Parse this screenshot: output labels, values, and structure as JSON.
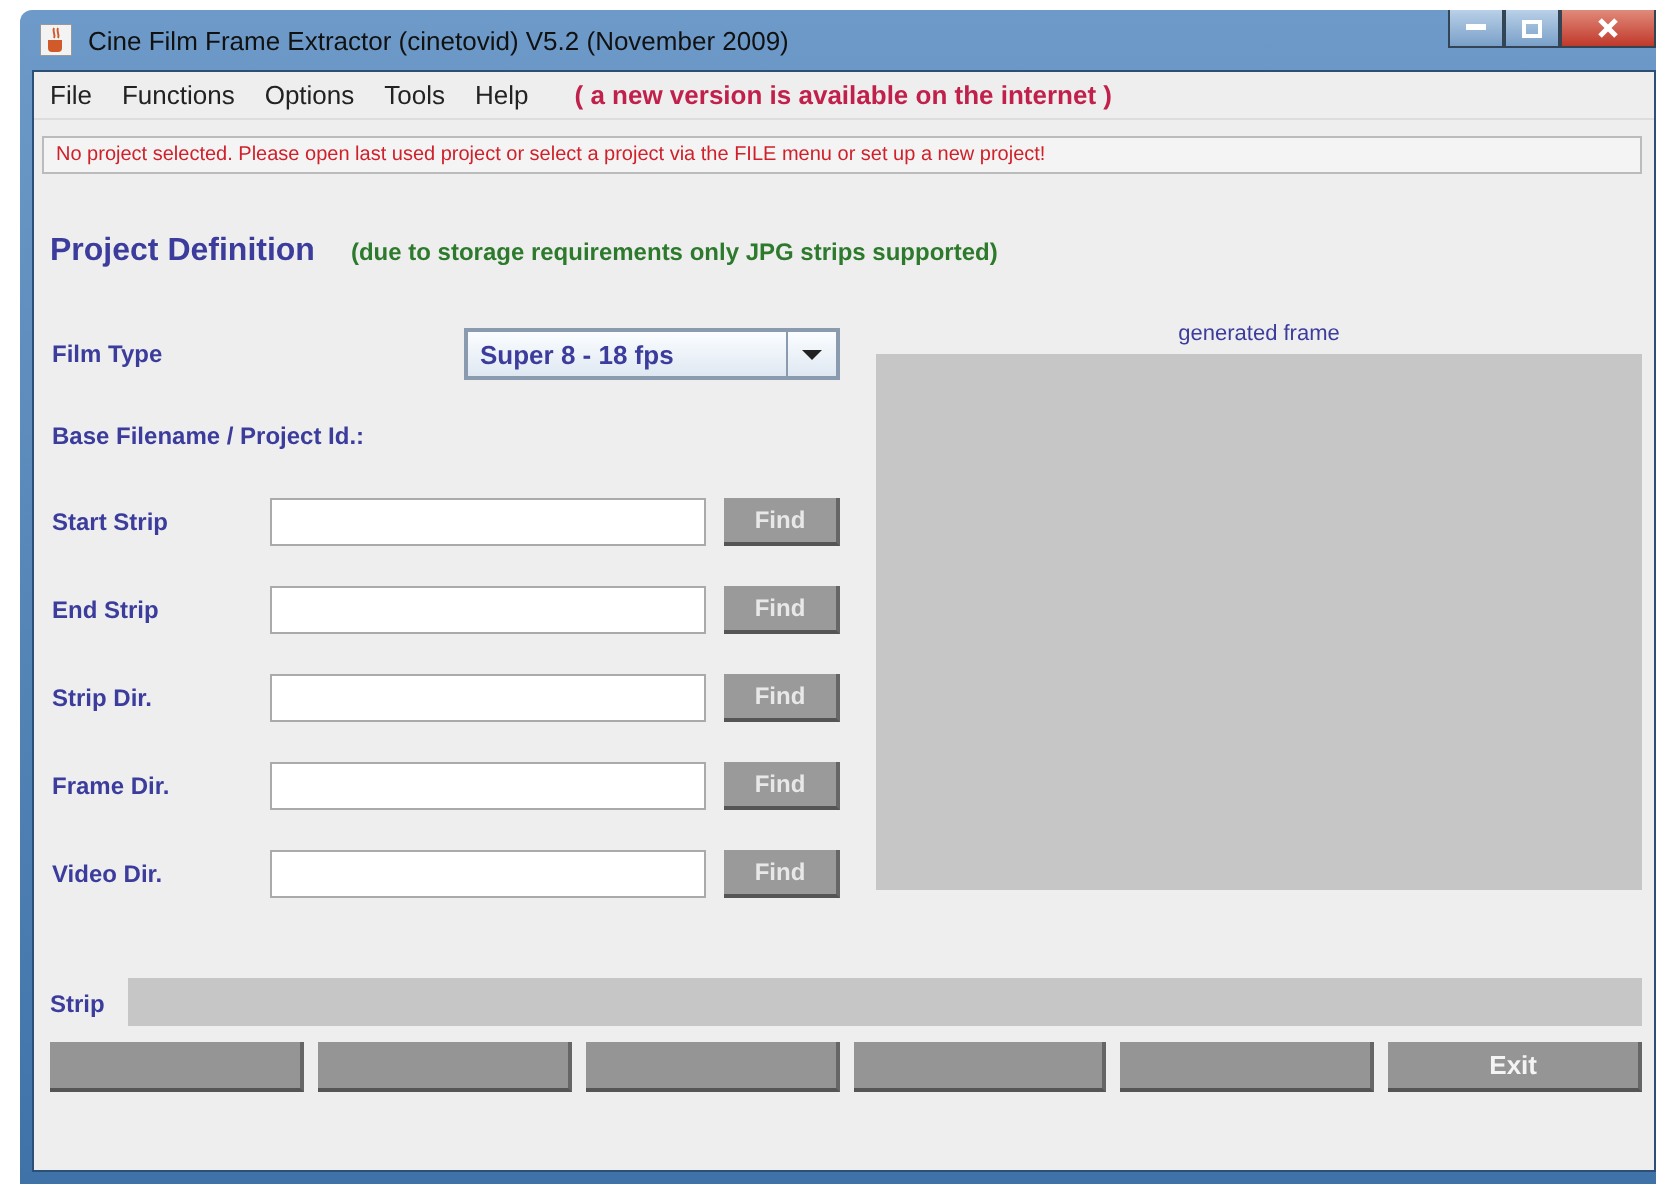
{
  "window": {
    "title": "Cine Film Frame Extractor (cinetovid) V5.2 (November 2009)"
  },
  "menu": [
    "File",
    "Functions",
    "Options",
    "Tools",
    "Help"
  ],
  "menu_notice": "( a new version is available on the internet )",
  "message": "No project selected. Please open last used project or select a project via the FILE menu or set up a new project!",
  "heading": "Project Definition",
  "heading_note": "(due to storage requirements only JPG strips supported)",
  "film_type": {
    "label": "Film Type",
    "value": "Super 8  - 18 fps"
  },
  "base_label": "Base Filename / Project Id.:",
  "fields": [
    {
      "label": "Start Strip",
      "button": "Find"
    },
    {
      "label": "End Strip",
      "button": "Find"
    },
    {
      "label": "Strip Dir.",
      "button": "Find"
    },
    {
      "label": "Frame Dir.",
      "button": "Find"
    },
    {
      "label": "Video  Dir.",
      "button": "Find"
    }
  ],
  "preview": {
    "label": "generated frame"
  },
  "strip_label": "Strip",
  "buttons": [
    {
      "kind": "blank"
    },
    {
      "kind": "blank"
    },
    {
      "kind": "blank"
    },
    {
      "kind": "blank"
    },
    {
      "kind": "blank"
    },
    {
      "kind": "labeled",
      "label": "Exit"
    }
  ]
}
